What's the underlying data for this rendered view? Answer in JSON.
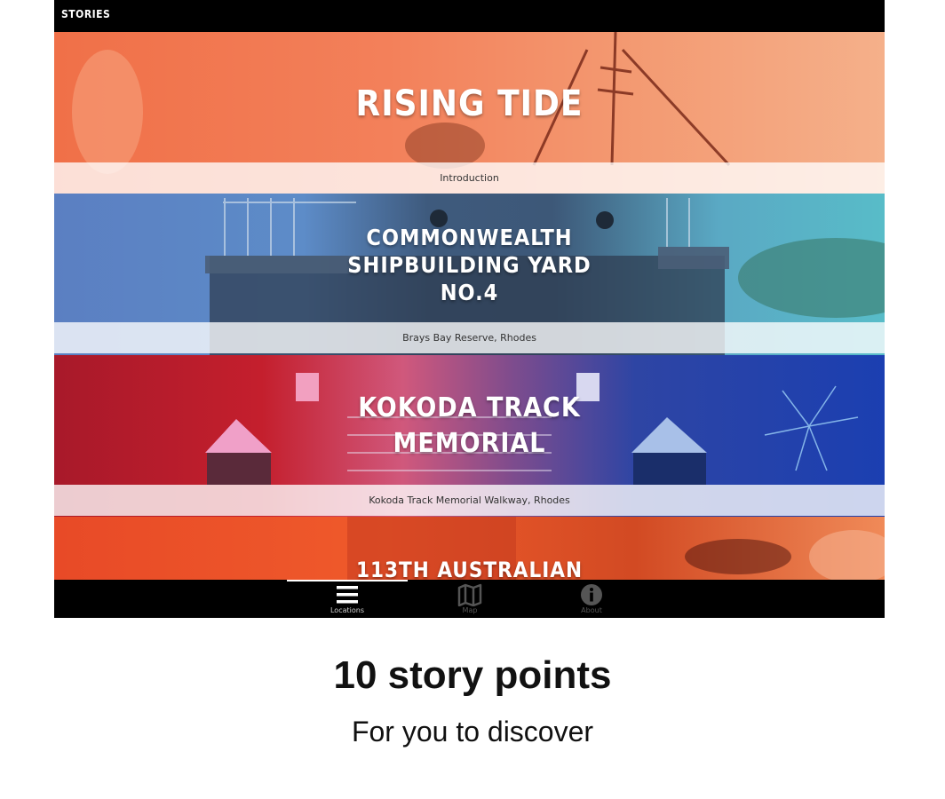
{
  "app": {
    "title": "STORIES"
  },
  "stories": [
    {
      "title": "RISING TIDE",
      "subtitle": "Introduction"
    },
    {
      "title_lines": [
        "COMMONWEALTH",
        "SHIPBUILDING YARD",
        "NO.4"
      ],
      "subtitle": "Brays Bay Reserve, Rhodes"
    },
    {
      "title_lines": [
        "KOKODA TRACK",
        "MEMORIAL"
      ],
      "subtitle": "Kokoda Track Memorial Walkway, Rhodes"
    },
    {
      "title": "113TH AUSTRALIAN"
    }
  ],
  "tabs": [
    {
      "label": "Locations",
      "icon": "list-icon",
      "active": true
    },
    {
      "label": "Map",
      "icon": "map-icon",
      "active": false
    },
    {
      "label": "About",
      "icon": "info-icon",
      "active": false
    }
  ],
  "promo": {
    "headline": "10 story points",
    "subline": "For you to discover"
  },
  "colors": {
    "bar": "#000000",
    "story1": "#f07048",
    "story2": "#5b7fc2",
    "story3": "#c41f2d",
    "story4": "#e84a27"
  }
}
